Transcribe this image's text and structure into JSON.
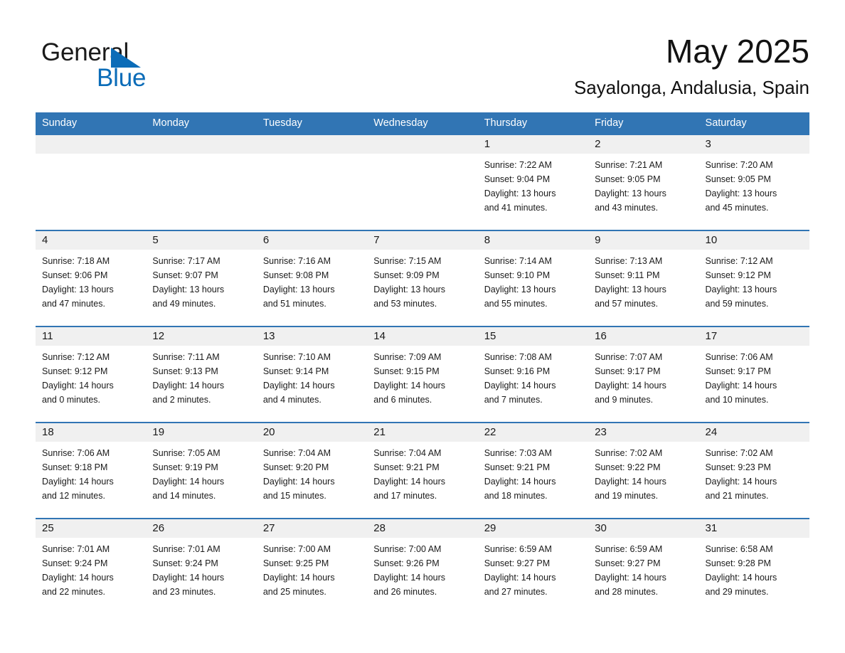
{
  "brand": {
    "name_part1": "General",
    "name_part2": "Blue",
    "triangle_color": "#0b6cb8",
    "text_color": "#1a1a1a"
  },
  "header": {
    "title": "May 2025",
    "subtitle": "Sayalonga, Andalusia, Spain"
  },
  "theme": {
    "header_blue": "#3175b4",
    "row_separator_blue": "#3175b4",
    "daynum_band_gray": "#f0f0f0",
    "text_black": "#1a1a1a",
    "page_background": "#ffffff"
  },
  "calendar": {
    "weekdays": [
      "Sunday",
      "Monday",
      "Tuesday",
      "Wednesday",
      "Thursday",
      "Friday",
      "Saturday"
    ],
    "weeks": [
      {
        "days": [
          {
            "num": "",
            "sunrise": "",
            "sunset": "",
            "daylight1": "",
            "daylight2": ""
          },
          {
            "num": "",
            "sunrise": "",
            "sunset": "",
            "daylight1": "",
            "daylight2": ""
          },
          {
            "num": "",
            "sunrise": "",
            "sunset": "",
            "daylight1": "",
            "daylight2": ""
          },
          {
            "num": "",
            "sunrise": "",
            "sunset": "",
            "daylight1": "",
            "daylight2": ""
          },
          {
            "num": "1",
            "sunrise": "Sunrise: 7:22 AM",
            "sunset": "Sunset: 9:04 PM",
            "daylight1": "Daylight: 13 hours",
            "daylight2": "and 41 minutes."
          },
          {
            "num": "2",
            "sunrise": "Sunrise: 7:21 AM",
            "sunset": "Sunset: 9:05 PM",
            "daylight1": "Daylight: 13 hours",
            "daylight2": "and 43 minutes."
          },
          {
            "num": "3",
            "sunrise": "Sunrise: 7:20 AM",
            "sunset": "Sunset: 9:05 PM",
            "daylight1": "Daylight: 13 hours",
            "daylight2": "and 45 minutes."
          }
        ]
      },
      {
        "days": [
          {
            "num": "4",
            "sunrise": "Sunrise: 7:18 AM",
            "sunset": "Sunset: 9:06 PM",
            "daylight1": "Daylight: 13 hours",
            "daylight2": "and 47 minutes."
          },
          {
            "num": "5",
            "sunrise": "Sunrise: 7:17 AM",
            "sunset": "Sunset: 9:07 PM",
            "daylight1": "Daylight: 13 hours",
            "daylight2": "and 49 minutes."
          },
          {
            "num": "6",
            "sunrise": "Sunrise: 7:16 AM",
            "sunset": "Sunset: 9:08 PM",
            "daylight1": "Daylight: 13 hours",
            "daylight2": "and 51 minutes."
          },
          {
            "num": "7",
            "sunrise": "Sunrise: 7:15 AM",
            "sunset": "Sunset: 9:09 PM",
            "daylight1": "Daylight: 13 hours",
            "daylight2": "and 53 minutes."
          },
          {
            "num": "8",
            "sunrise": "Sunrise: 7:14 AM",
            "sunset": "Sunset: 9:10 PM",
            "daylight1": "Daylight: 13 hours",
            "daylight2": "and 55 minutes."
          },
          {
            "num": "9",
            "sunrise": "Sunrise: 7:13 AM",
            "sunset": "Sunset: 9:11 PM",
            "daylight1": "Daylight: 13 hours",
            "daylight2": "and 57 minutes."
          },
          {
            "num": "10",
            "sunrise": "Sunrise: 7:12 AM",
            "sunset": "Sunset: 9:12 PM",
            "daylight1": "Daylight: 13 hours",
            "daylight2": "and 59 minutes."
          }
        ]
      },
      {
        "days": [
          {
            "num": "11",
            "sunrise": "Sunrise: 7:12 AM",
            "sunset": "Sunset: 9:12 PM",
            "daylight1": "Daylight: 14 hours",
            "daylight2": "and 0 minutes."
          },
          {
            "num": "12",
            "sunrise": "Sunrise: 7:11 AM",
            "sunset": "Sunset: 9:13 PM",
            "daylight1": "Daylight: 14 hours",
            "daylight2": "and 2 minutes."
          },
          {
            "num": "13",
            "sunrise": "Sunrise: 7:10 AM",
            "sunset": "Sunset: 9:14 PM",
            "daylight1": "Daylight: 14 hours",
            "daylight2": "and 4 minutes."
          },
          {
            "num": "14",
            "sunrise": "Sunrise: 7:09 AM",
            "sunset": "Sunset: 9:15 PM",
            "daylight1": "Daylight: 14 hours",
            "daylight2": "and 6 minutes."
          },
          {
            "num": "15",
            "sunrise": "Sunrise: 7:08 AM",
            "sunset": "Sunset: 9:16 PM",
            "daylight1": "Daylight: 14 hours",
            "daylight2": "and 7 minutes."
          },
          {
            "num": "16",
            "sunrise": "Sunrise: 7:07 AM",
            "sunset": "Sunset: 9:17 PM",
            "daylight1": "Daylight: 14 hours",
            "daylight2": "and 9 minutes."
          },
          {
            "num": "17",
            "sunrise": "Sunrise: 7:06 AM",
            "sunset": "Sunset: 9:17 PM",
            "daylight1": "Daylight: 14 hours",
            "daylight2": "and 10 minutes."
          }
        ]
      },
      {
        "days": [
          {
            "num": "18",
            "sunrise": "Sunrise: 7:06 AM",
            "sunset": "Sunset: 9:18 PM",
            "daylight1": "Daylight: 14 hours",
            "daylight2": "and 12 minutes."
          },
          {
            "num": "19",
            "sunrise": "Sunrise: 7:05 AM",
            "sunset": "Sunset: 9:19 PM",
            "daylight1": "Daylight: 14 hours",
            "daylight2": "and 14 minutes."
          },
          {
            "num": "20",
            "sunrise": "Sunrise: 7:04 AM",
            "sunset": "Sunset: 9:20 PM",
            "daylight1": "Daylight: 14 hours",
            "daylight2": "and 15 minutes."
          },
          {
            "num": "21",
            "sunrise": "Sunrise: 7:04 AM",
            "sunset": "Sunset: 9:21 PM",
            "daylight1": "Daylight: 14 hours",
            "daylight2": "and 17 minutes."
          },
          {
            "num": "22",
            "sunrise": "Sunrise: 7:03 AM",
            "sunset": "Sunset: 9:21 PM",
            "daylight1": "Daylight: 14 hours",
            "daylight2": "and 18 minutes."
          },
          {
            "num": "23",
            "sunrise": "Sunrise: 7:02 AM",
            "sunset": "Sunset: 9:22 PM",
            "daylight1": "Daylight: 14 hours",
            "daylight2": "and 19 minutes."
          },
          {
            "num": "24",
            "sunrise": "Sunrise: 7:02 AM",
            "sunset": "Sunset: 9:23 PM",
            "daylight1": "Daylight: 14 hours",
            "daylight2": "and 21 minutes."
          }
        ]
      },
      {
        "days": [
          {
            "num": "25",
            "sunrise": "Sunrise: 7:01 AM",
            "sunset": "Sunset: 9:24 PM",
            "daylight1": "Daylight: 14 hours",
            "daylight2": "and 22 minutes."
          },
          {
            "num": "26",
            "sunrise": "Sunrise: 7:01 AM",
            "sunset": "Sunset: 9:24 PM",
            "daylight1": "Daylight: 14 hours",
            "daylight2": "and 23 minutes."
          },
          {
            "num": "27",
            "sunrise": "Sunrise: 7:00 AM",
            "sunset": "Sunset: 9:25 PM",
            "daylight1": "Daylight: 14 hours",
            "daylight2": "and 25 minutes."
          },
          {
            "num": "28",
            "sunrise": "Sunrise: 7:00 AM",
            "sunset": "Sunset: 9:26 PM",
            "daylight1": "Daylight: 14 hours",
            "daylight2": "and 26 minutes."
          },
          {
            "num": "29",
            "sunrise": "Sunrise: 6:59 AM",
            "sunset": "Sunset: 9:27 PM",
            "daylight1": "Daylight: 14 hours",
            "daylight2": "and 27 minutes."
          },
          {
            "num": "30",
            "sunrise": "Sunrise: 6:59 AM",
            "sunset": "Sunset: 9:27 PM",
            "daylight1": "Daylight: 14 hours",
            "daylight2": "and 28 minutes."
          },
          {
            "num": "31",
            "sunrise": "Sunrise: 6:58 AM",
            "sunset": "Sunset: 9:28 PM",
            "daylight1": "Daylight: 14 hours",
            "daylight2": "and 29 minutes."
          }
        ]
      }
    ]
  }
}
